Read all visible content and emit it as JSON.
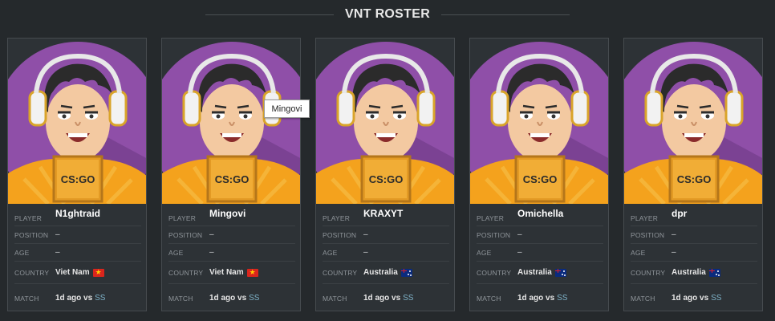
{
  "header": {
    "title": "VNT ROSTER"
  },
  "labels": {
    "player": "PLAYER",
    "position": "POSITION",
    "age": "AGE",
    "country": "COUNTRY",
    "match": "MATCH"
  },
  "players": [
    {
      "name": "N1ghtraid",
      "position": "–",
      "age": "–",
      "country": "Viet Nam",
      "flag": "vn-flag-icon",
      "match_prefix": "1d ago vs",
      "match_opponent": "SS"
    },
    {
      "name": "Mingovi",
      "position": "–",
      "age": "–",
      "country": "Viet Nam",
      "flag": "vn-flag-icon",
      "match_prefix": "1d ago vs",
      "match_opponent": "SS"
    },
    {
      "name": "KRAXYT",
      "position": "–",
      "age": "–",
      "country": "Australia",
      "flag": "au-flag-icon",
      "match_prefix": "1d ago vs",
      "match_opponent": "SS"
    },
    {
      "name": "Omichella",
      "position": "–",
      "age": "–",
      "country": "Australia",
      "flag": "au-flag-icon",
      "match_prefix": "1d ago vs",
      "match_opponent": "SS"
    },
    {
      "name": "dpr",
      "position": "–",
      "age": "–",
      "country": "Australia",
      "flag": "au-flag-icon",
      "match_prefix": "1d ago vs",
      "match_opponent": "SS"
    }
  ],
  "tooltip": {
    "text": "Mingovi"
  },
  "avatar": {
    "badge_text": "CS:GO"
  },
  "colors": {
    "background": "#25292c",
    "card": "#2d3236",
    "avatar_purple": "#8f4fa8",
    "shirt_orange": "#f4a21d",
    "opponent_link": "#7fb3c9"
  }
}
